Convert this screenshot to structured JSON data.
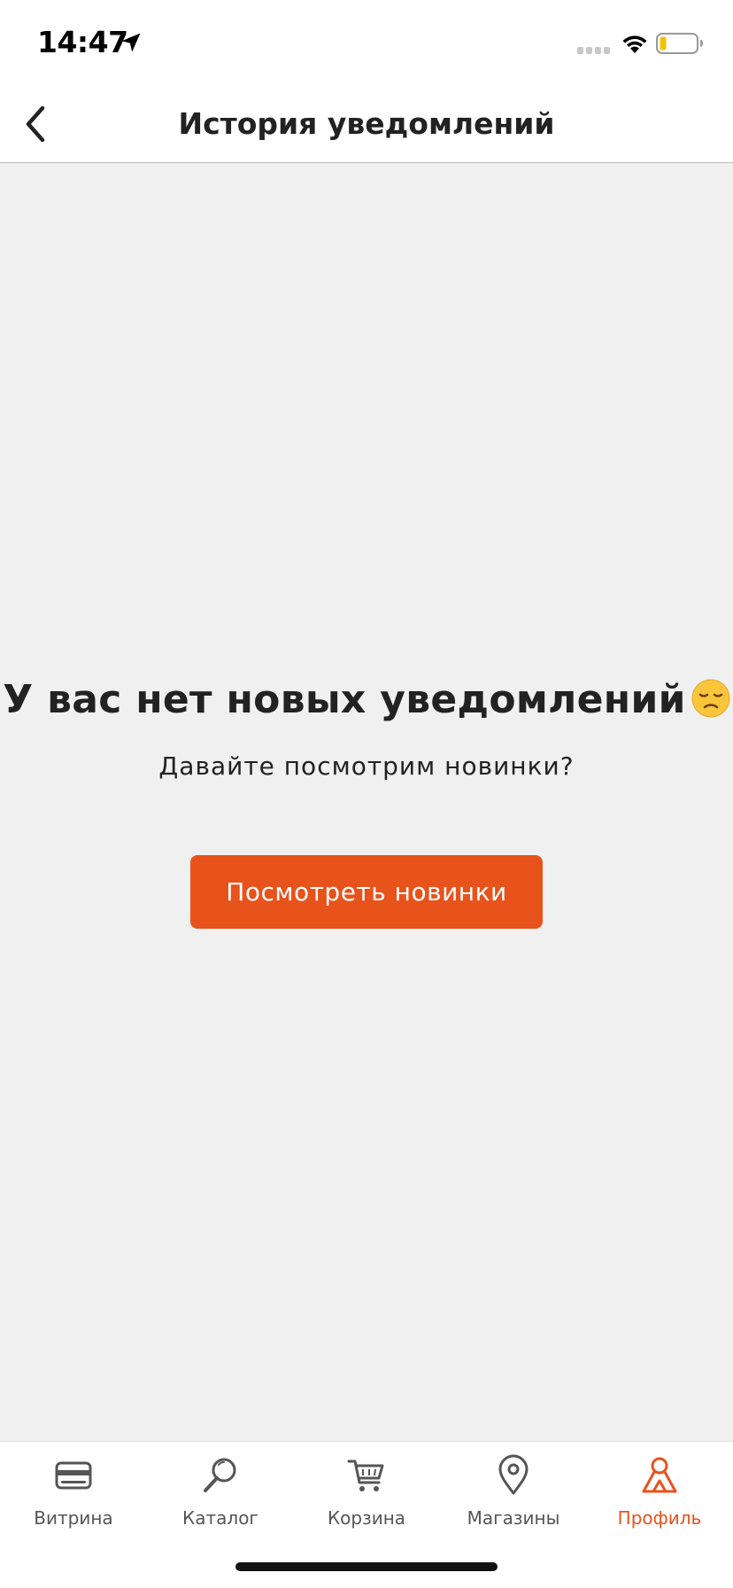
{
  "status_bar": {
    "time": "14:47",
    "icons": [
      "location-arrow-icon",
      "signal-icon",
      "wifi-icon",
      "battery-icon"
    ]
  },
  "nav": {
    "title": "История уведомлений",
    "back_icon": "chevron-left-icon"
  },
  "empty_state": {
    "title": "У вас нет новых уведомлений",
    "emoji_icon": "disappointed-face-icon",
    "subtitle": "Давайте посмотрим новинки?",
    "button_label": "Посмотреть новинки"
  },
  "tabs": [
    {
      "label": "Витрина",
      "icon": "card-icon",
      "active": false
    },
    {
      "label": "Каталог",
      "icon": "search-icon",
      "active": false
    },
    {
      "label": "Корзина",
      "icon": "cart-icon",
      "active": false
    },
    {
      "label": "Магазины",
      "icon": "map-pin-icon",
      "active": false
    },
    {
      "label": "Профиль",
      "icon": "profile-icon",
      "active": true
    }
  ],
  "colors": {
    "accent": "#e8521b",
    "background": "#f0f0f0",
    "text": "#222222",
    "tab_inactive": "#555555"
  }
}
